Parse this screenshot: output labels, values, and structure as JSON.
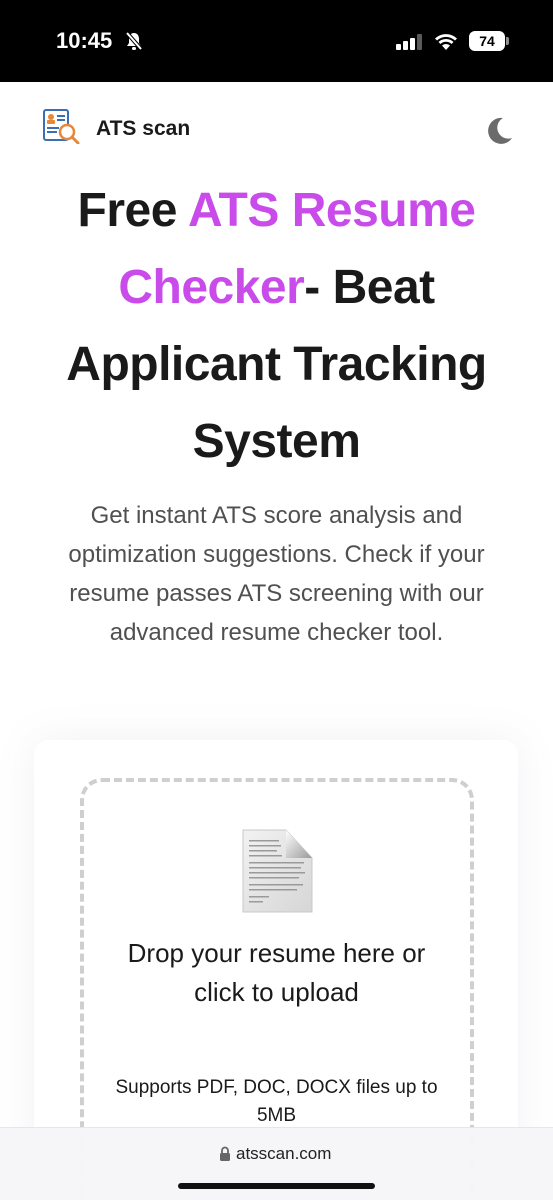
{
  "status_bar": {
    "time": "10:45",
    "battery": "74"
  },
  "header": {
    "brand": "ATS scan",
    "logo_icon": "resume-search-icon",
    "theme_icon": "moon-icon"
  },
  "hero": {
    "title_part1": "Free ",
    "title_accent": "ATS Resume Checker",
    "title_part2": "- Beat Applicant Tracking System",
    "subtitle": "Get instant ATS score analysis and optimization suggestions. Check if your resume passes ATS screening with our advanced resume checker tool."
  },
  "upload": {
    "icon": "document-icon",
    "prompt": "Drop your resume here or click to upload",
    "supports": "Supports PDF, DOC, DOCX files up to 5MB"
  },
  "browser": {
    "url": "atsscan.com",
    "lock_icon": "lock-icon"
  },
  "colors": {
    "accent": "#c84bea",
    "text": "#1a1a1a",
    "muted": "#505050"
  }
}
